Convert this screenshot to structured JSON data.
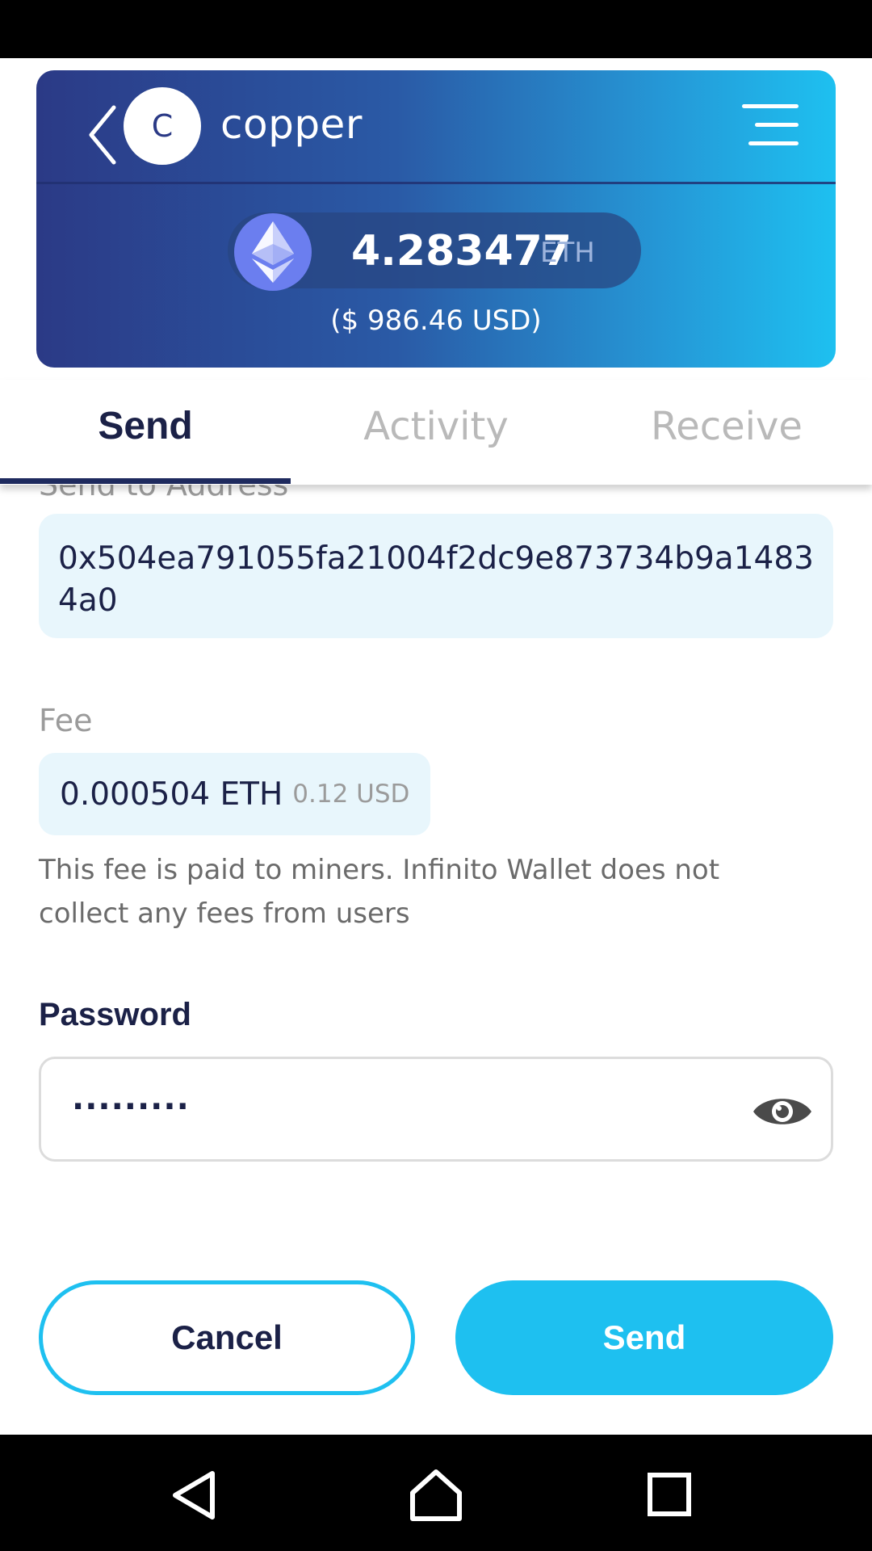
{
  "header": {
    "avatar_letter": "C",
    "wallet_name": "copper",
    "balance_amount": "4.283477",
    "balance_unit": "ETH",
    "balance_usd": "($ 986.46 USD)",
    "icons": {
      "back": "chevron-left-icon",
      "menu": "hamburger-menu-icon",
      "coin": "ethereum-icon"
    },
    "gradient": [
      "#2b3a86",
      "#1ec0f0"
    ]
  },
  "tabs": {
    "send": "Send",
    "activity": "Activity",
    "receive": "Receive",
    "active": "send"
  },
  "form": {
    "address_label": "Send to Address",
    "address_value": "0x504ea791055fa21004f2dc9e873734b9a14834a0",
    "fee_label": "Fee",
    "fee_eth": "0.000504 ETH",
    "fee_usd": "0.12 USD",
    "fee_note": "This fee is paid to miners. Infinito Wallet does not collect any fees from users",
    "password_label": "Password",
    "password_value": "·········",
    "password_toggle_icon": "eye-icon"
  },
  "actions": {
    "cancel_label": "Cancel",
    "send_label": "Send",
    "accent_color": "#1ec0f0"
  },
  "system_nav": {
    "icons": [
      "back-triangle-icon",
      "home-icon",
      "recents-square-icon"
    ]
  }
}
